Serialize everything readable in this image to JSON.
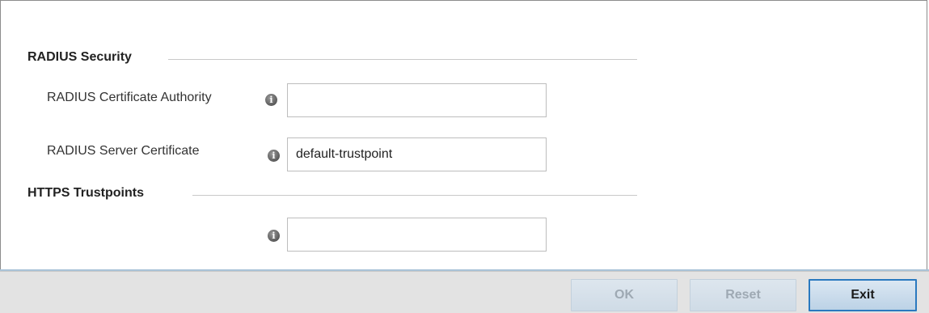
{
  "radius_security": {
    "title": "RADIUS Security",
    "certificate_authority": {
      "label": "RADIUS Certificate Authority",
      "value": "",
      "info_icon": "info-icon"
    },
    "server_certificate": {
      "label": "RADIUS Server Certificate",
      "value": "default-trustpoint",
      "info_icon": "info-icon"
    }
  },
  "https_trustpoints": {
    "title": "HTTPS Trustpoints",
    "trustpoint": {
      "value": "",
      "info_icon": "info-icon"
    }
  },
  "footer": {
    "ok_label": "OK",
    "reset_label": "Reset",
    "exit_label": "Exit"
  },
  "colors": {
    "accent": "#2a79bf",
    "footer_bg": "#e3e3e3"
  }
}
